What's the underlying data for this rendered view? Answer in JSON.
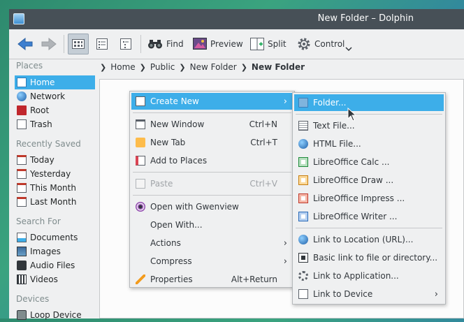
{
  "window": {
    "title": "New Folder – Dolphin"
  },
  "toolbar": {
    "back_icon": "back-arrow-icon",
    "forward_icon": "forward-arrow-icon",
    "find": "Find",
    "preview": "Preview",
    "split": "Split",
    "control": "Control"
  },
  "breadcrumb": [
    "Home",
    "Public",
    "New Folder",
    "New Folder"
  ],
  "places": {
    "sections": {
      "places": "Places",
      "recent": "Recently Saved",
      "search": "Search For",
      "devices": "Devices"
    },
    "items": {
      "home": "Home",
      "network": "Network",
      "root": "Root",
      "trash": "Trash",
      "today": "Today",
      "yesterday": "Yesterday",
      "this_month": "This Month",
      "last_month": "Last Month",
      "documents": "Documents",
      "images": "Images",
      "audio": "Audio Files",
      "videos": "Videos",
      "loop": "Loop Device"
    }
  },
  "context_menu": {
    "create_new": "Create New",
    "new_window": "New Window",
    "new_window_sc": "Ctrl+N",
    "new_tab": "New Tab",
    "new_tab_sc": "Ctrl+T",
    "add_places": "Add to Places",
    "paste": "Paste",
    "paste_sc": "Ctrl+V",
    "open_gwenview": "Open with Gwenview",
    "open_with": "Open With...",
    "actions": "Actions",
    "compress": "Compress",
    "properties": "Properties",
    "properties_sc": "Alt+Return"
  },
  "submenu": {
    "folder": "Folder...",
    "text_file": "Text File...",
    "html_file": "HTML File...",
    "calc": "LibreOffice Calc  ...",
    "draw": "LibreOffice Draw  ...",
    "impress": "LibreOffice Impress  ...",
    "writer": "LibreOffice Writer  ...",
    "link_url": "Link to Location (URL)...",
    "basic_link": "Basic link to file or directory...",
    "link_app": "Link to Application...",
    "link_device": "Link to Device"
  },
  "colors": {
    "accent": "#3daee9",
    "titlebar": "#475057",
    "window_bg": "#eff0f1"
  }
}
